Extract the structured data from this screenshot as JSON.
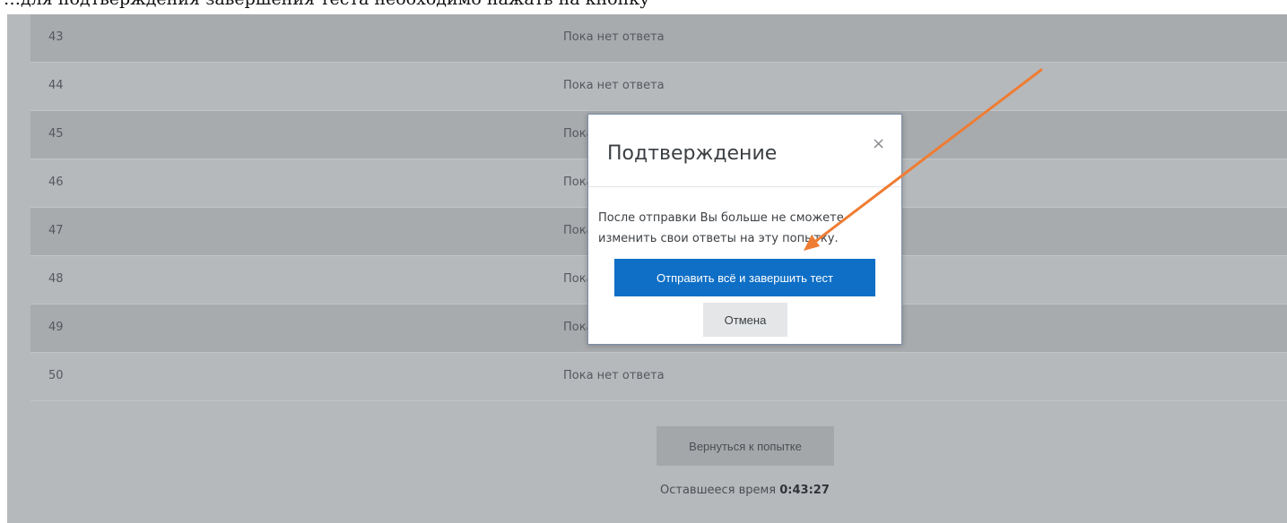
{
  "caption_text": "…для подтверждения завершения теста необходимо нажать на кнопку",
  "summary": {
    "rows": [
      {
        "num": "43",
        "status": "Пока нет ответа"
      },
      {
        "num": "44",
        "status": "Пока нет ответа"
      },
      {
        "num": "45",
        "status": "Пока нет ответа"
      },
      {
        "num": "46",
        "status": "Пока нет ответа"
      },
      {
        "num": "47",
        "status": "Пока нет ответа"
      },
      {
        "num": "48",
        "status": "Пока нет ответа"
      },
      {
        "num": "49",
        "status": "Пока нет ответа"
      },
      {
        "num": "50",
        "status": "Пока нет ответа"
      }
    ],
    "return_label": "Вернуться к попытке",
    "time_left_label": "Оставшееся время",
    "time_left_value": "0:43:27"
  },
  "modal": {
    "title": "Подтверждение",
    "close_glyph": "×",
    "body_line1": "После отправки Вы больше не сможете",
    "body_line2": "изменить свои ответы на эту попытку.",
    "submit_label": "Отправить всё и завершить тест",
    "cancel_label": "Отмена"
  },
  "colors": {
    "overlay_row_dark": "#a8abae",
    "overlay_row_light": "#b6b9bc",
    "primary_button": "#0f6fc6",
    "arrow": "#ee7d34"
  },
  "icons": {
    "close": "close-icon",
    "annotation": "arrow-annotation"
  }
}
